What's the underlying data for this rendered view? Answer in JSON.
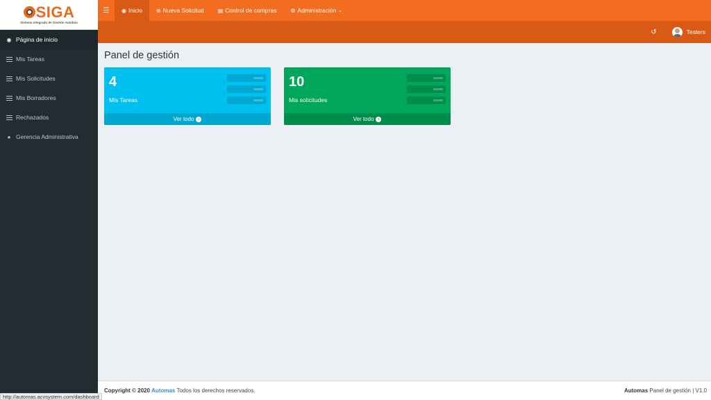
{
  "logo": {
    "text": "SIGA",
    "subtitle": "Sistema Integrado de Gestión Autobús"
  },
  "sidebar": {
    "items": [
      {
        "label": "Página de inicio",
        "icon": "dashboard-icon",
        "active": true
      },
      {
        "label": "Mis Tareas",
        "icon": "list-icon"
      },
      {
        "label": "Mis Solicitudes",
        "icon": "list-icon"
      },
      {
        "label": "Mis Borradores",
        "icon": "list-icon"
      },
      {
        "label": "Rechazados",
        "icon": "list-icon"
      },
      {
        "label": "Gerencia Administrativa",
        "icon": "user-icon"
      }
    ]
  },
  "topnav": {
    "items": [
      {
        "label": "Inicio",
        "icon": "dashboard-icon",
        "active": true
      },
      {
        "label": "Nueva Solicitud",
        "icon": "plus-circle-icon"
      },
      {
        "label": "Control de compras",
        "icon": "list-icon"
      },
      {
        "label": "Administración",
        "icon": "gears-icon",
        "dropdown": true
      }
    ]
  },
  "user": {
    "name": "Testers"
  },
  "page": {
    "title": "Panel de gestión"
  },
  "cards": [
    {
      "value": "4",
      "label": "Mis Tareas",
      "link": "Ver todo",
      "color": "#00c0ef"
    },
    {
      "value": "10",
      "label": "Mis solicitudes",
      "link": "Ver todo",
      "color": "#00a65a"
    }
  ],
  "footer": {
    "copyright_prefix": "Copyright © 2020",
    "brand": "Automas",
    "rights": "Todos los derechos reservados.",
    "right_brand": "Automas",
    "right_text": "Panel de gestión | V1.0"
  },
  "statusbar": {
    "url": "http://automas.acvsystem.com/dashboard"
  },
  "colors": {
    "accent": "#f36d21",
    "sidebar": "#222d32",
    "card_blue": "#00c0ef",
    "card_green": "#00a65a"
  }
}
